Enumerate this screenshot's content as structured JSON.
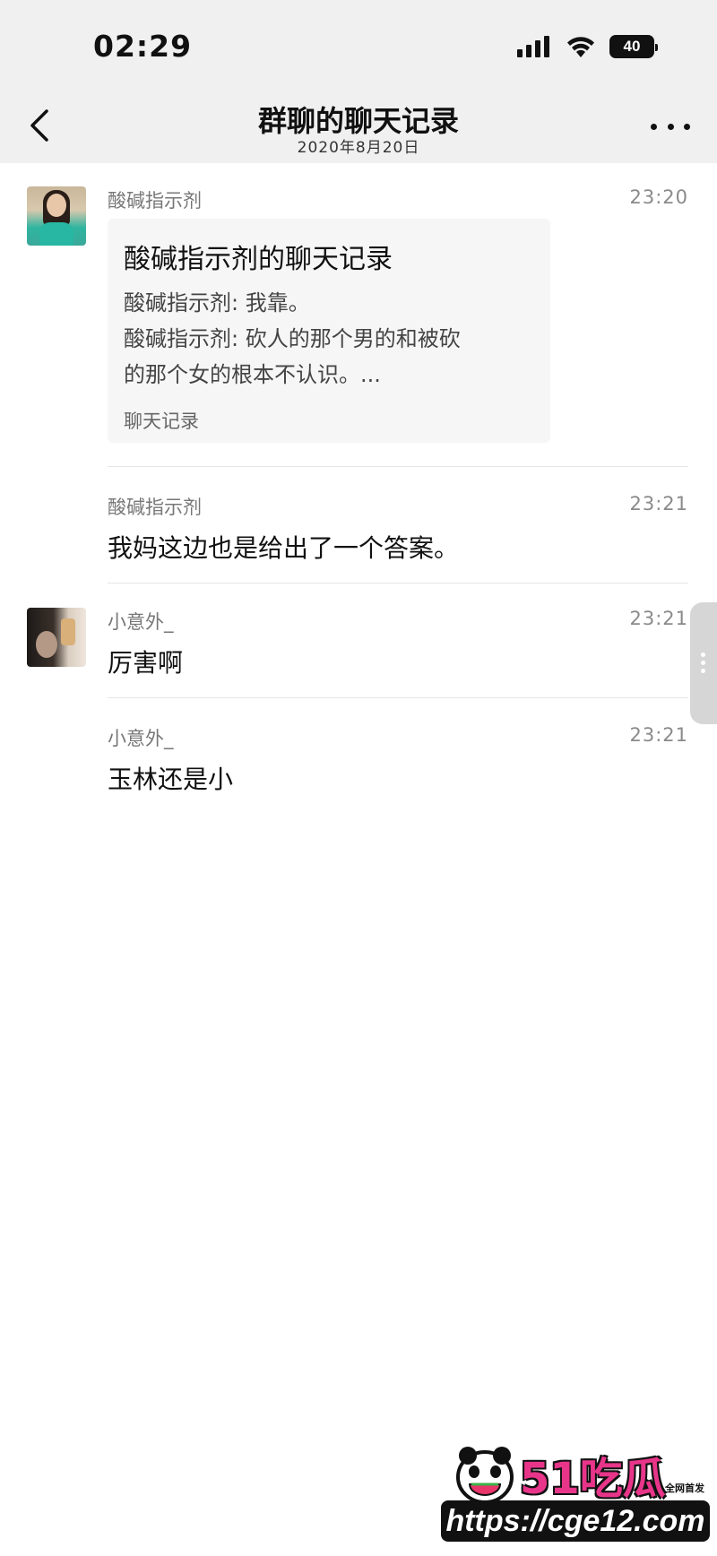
{
  "status_bar": {
    "time": "02:29",
    "battery": "40",
    "icons": [
      "signal-icon",
      "wifi-icon",
      "battery-icon"
    ]
  },
  "nav": {
    "back_icon": "chevron-left-icon",
    "title": "群聊的聊天记录",
    "subtitle": "2020年8月20日",
    "more_icon": "more-dots-icon"
  },
  "messages": [
    {
      "sender": "酸碱指示剂",
      "time": "23:20",
      "card": {
        "title": "酸碱指示剂的聊天记录",
        "lines": [
          "酸碱指示剂: 我靠。",
          "酸碱指示剂: 砍人的那个男的和被砍",
          "的那个女的根本不认识。..."
        ],
        "footer": "聊天记录"
      }
    },
    {
      "sender": "酸碱指示剂",
      "time": "23:21",
      "text": "我妈这边也是给出了一个答案。"
    },
    {
      "sender": "小意外_",
      "time": "23:21",
      "text": "厉害啊"
    },
    {
      "sender": "小意外_",
      "time": "23:21",
      "text": "玉林还是小"
    }
  ],
  "watermark": {
    "logo_text": "51吃瓜",
    "badge": "全网首发",
    "url": "https://cge12.com"
  },
  "colors": {
    "header_bg": "#f0f0f0",
    "card_bg": "#f6f6f6",
    "accent": "#e8358a"
  }
}
